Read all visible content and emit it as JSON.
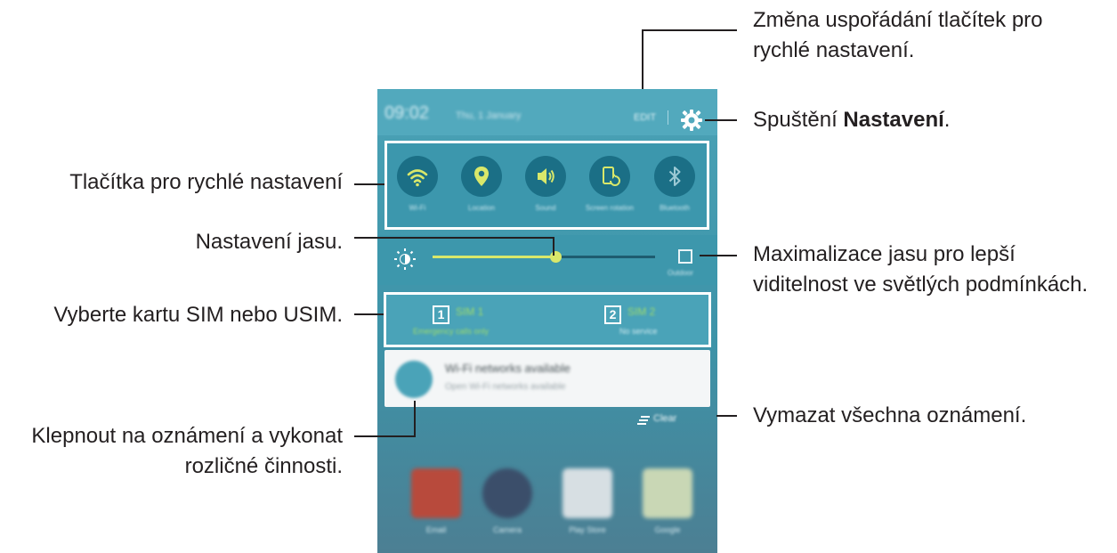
{
  "callouts": {
    "rearrange": [
      "Změna uspořádání tlačítek pro",
      "rychlé nastavení."
    ],
    "settings_prefix": "Spuštění ",
    "settings_bold": "Nastavení",
    "settings_suffix": ".",
    "quick_buttons": "Tlačítka pro rychlé nastavení",
    "brightness": "Nastavení jasu.",
    "outdoor": [
      "Maximalizace jasu pro lepší",
      "viditelnost ve světlých podmínkách."
    ],
    "sim": "Vyberte kartu SIM nebo USIM.",
    "notification": [
      "Klepnout na oznámení a vykonat",
      "rozličné činnosti."
    ],
    "clear": "Vymazat všechna oznámení."
  },
  "phone": {
    "clock": "09:02",
    "date": "Thu, 1 January",
    "edit_label": "EDIT",
    "quick_settings": [
      {
        "icon": "wifi-icon",
        "label": "Wi-Fi"
      },
      {
        "icon": "location-icon",
        "label": "Location"
      },
      {
        "icon": "sound-icon",
        "label": "Sound"
      },
      {
        "icon": "screen-rotation-icon",
        "label": "Screen rotation"
      },
      {
        "icon": "bluetooth-icon",
        "label": "Bluetooth"
      }
    ],
    "brightness": {
      "level": 0.55,
      "outdoor_label": "Outdoor"
    },
    "sim_cards": [
      {
        "number": "1",
        "name": "SIM 1",
        "status": "Emergency calls only"
      },
      {
        "number": "2",
        "name": "SIM 2",
        "status": "No service"
      }
    ],
    "notification": {
      "title": "Wi-Fi networks available",
      "subtitle": "Open Wi-Fi networks available"
    },
    "clear_label": "Clear",
    "apps": [
      "Email",
      "Camera",
      "Play Store",
      "Google"
    ],
    "colors": {
      "accent": "#d9e86a",
      "panel": "#3d97ac",
      "sim_text": "#9edb6c"
    }
  }
}
